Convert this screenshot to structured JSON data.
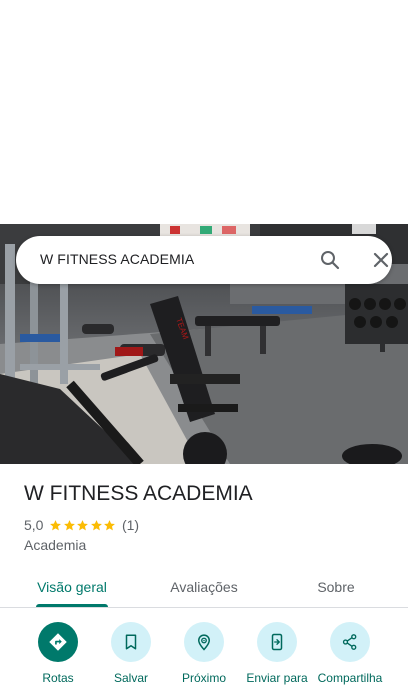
{
  "search": {
    "query": "W FITNESS ACADEMIA"
  },
  "place": {
    "name": "W FITNESS ACADEMIA",
    "rating": "5,0",
    "stars": 5,
    "review_count": "(1)",
    "category": "Academia"
  },
  "tabs": [
    {
      "label": "Visão geral",
      "active": true
    },
    {
      "label": "Avaliações",
      "active": false
    },
    {
      "label": "Sobre",
      "active": false
    }
  ],
  "actions": [
    {
      "label": "Rotas",
      "icon": "directions-icon"
    },
    {
      "label": "Salvar",
      "icon": "bookmark-icon"
    },
    {
      "label": "Próximo",
      "icon": "nearby-icon"
    },
    {
      "label": "Enviar para",
      "icon": "send-to-phone-icon"
    },
    {
      "label": "Compartilha",
      "icon": "share-icon"
    }
  ],
  "colors": {
    "accent": "#00796b",
    "action_bg": "#d2f1f8",
    "star": "#fbbc04",
    "text_primary": "#202124",
    "text_secondary": "#5f6368"
  }
}
